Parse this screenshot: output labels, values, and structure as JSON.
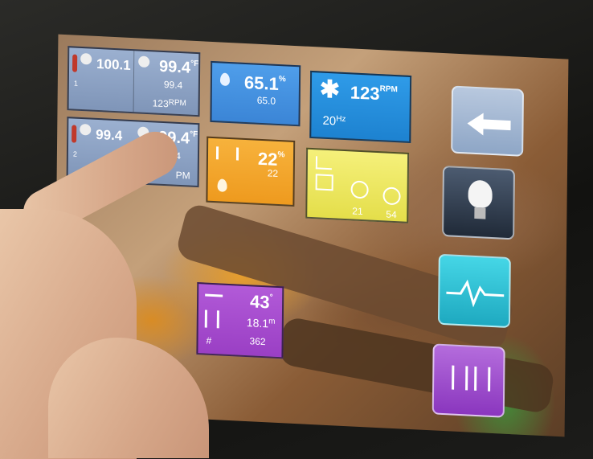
{
  "tiles": {
    "temp1": {
      "left_value": "100.1",
      "index": "1",
      "value": "99.4",
      "unit": "°F",
      "sub": "99.4",
      "rpm_value": "123",
      "rpm_unit": "RPM"
    },
    "temp2": {
      "left_value": "99.4",
      "index": "2",
      "value": "99.4",
      "unit": "°F",
      "sub": ".4",
      "rpm_value": "",
      "rpm_unit": "PM"
    },
    "humidity": {
      "value": "65.1",
      "unit": "%",
      "sub": "65.0"
    },
    "fan": {
      "value": "123",
      "unit": "RPM",
      "freq_value": "20",
      "freq_unit": "Hz"
    },
    "orange": {
      "value": "22",
      "unit": "%",
      "sub": "22"
    },
    "yellow": {
      "gauge1": "21",
      "gauge2": "54"
    },
    "purple": {
      "angle": "43",
      "angle_unit": "°",
      "distance": "18.1",
      "distance_unit": "m",
      "count": "362",
      "count_label": "#"
    }
  },
  "colors": {
    "blue": "#3b85d6",
    "orange": "#ee9a1e",
    "yellow": "#e4de4a",
    "purple": "#9a3fc4",
    "teal": "#2ec6d8"
  },
  "sidebar": {
    "icons": [
      "back-arrow-icon",
      "light-bulb-icon",
      "heartbeat-icon",
      "egg-tray-icon"
    ]
  }
}
